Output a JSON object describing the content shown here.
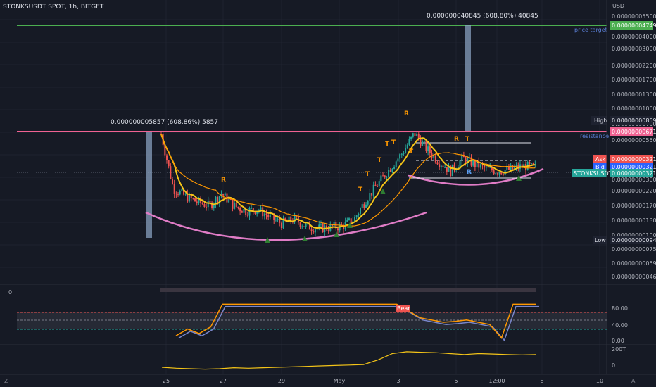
{
  "header": {
    "symbol_line": "STONKSUSDT SPOT, 1h, BITGET",
    "currency": "USDT"
  },
  "colors": {
    "background": "#161a25",
    "grid": "#1f2330",
    "up": "#26a69a",
    "down": "#ef5350",
    "green_line": "#4caf50",
    "pink_line": "#f06292",
    "bars_fill": "#8fa8c8",
    "orange": "#ff9800",
    "yellow": "#f5c518",
    "blue": "#5b7fd6"
  },
  "annotations": {
    "green_measure_label": "0.000000040845 (608.80%) 40845",
    "pink_measure_label": "0.000000005857 (608.86%) 5857",
    "price_target_label": "price target",
    "resistance_label": "resistance"
  },
  "markers": {
    "r_labels": [
      "R",
      "R",
      "R",
      "R"
    ],
    "t_labels": [
      "T",
      "T",
      "T",
      "T",
      "T",
      "T",
      "T"
    ],
    "bear_label": "Bear"
  },
  "price_scale": {
    "ticks": [
      "0.000000055000",
      "0.000000040000",
      "0.000000030000",
      "0.000000022000",
      "0.000000017000",
      "0.000000013000",
      "0.000000010000",
      "0.000000007500",
      "0.000000005500",
      "0.000000002200",
      "0.000000001700",
      "0.000000001300",
      "0.000000001000",
      "0.000000000750",
      "0.000000000590",
      "0.000000000460"
    ],
    "price_target_value": "0.000000047497",
    "high_label": "High",
    "high_value": "0.000000008599",
    "resistance_value": "0.000000006716",
    "ask_label": "Ask",
    "ask_value": "0.000000003214",
    "bid_label": "Bid",
    "bid_value": "0.000000003212",
    "last_label": "STONKSUSDT",
    "last_value": "0.000000003212",
    "low_label": "Low",
    "low_value": "0.000000000941",
    "partial_tick": "0.000000003000"
  },
  "osc_scale": [
    "80.00",
    "40.00",
    "0.00"
  ],
  "bottom_scale": [
    "200T",
    "0"
  ],
  "time_axis": [
    "25",
    "27",
    "29",
    "May",
    "3",
    "5",
    "12:00",
    "8",
    "10"
  ],
  "chart_data": {
    "type": "candlestick",
    "title": "STONKSUSDT SPOT, 1h, BITGET",
    "y_scale": "log",
    "x_labels": [
      "25",
      "27",
      "29",
      "May",
      "3",
      "5",
      "12:00",
      "8",
      "10"
    ],
    "x": [
      24.8,
      25.2,
      25.6,
      26.0,
      26.4,
      26.8,
      27.2,
      27.6,
      28.0,
      28.4,
      28.8,
      29.2,
      29.6,
      30.0,
      30.4,
      30.8,
      31.2,
      31.6,
      32.0,
      32.4,
      32.8,
      33.2,
      33.6,
      34.0,
      34.4,
      34.8,
      35.2,
      35.6,
      36.0,
      36.4,
      36.8,
      37.2
    ],
    "close": [
      5.9e-09,
      2.2e-09,
      1.9e-09,
      1.7e-09,
      1.6e-09,
      2e-09,
      1.6e-09,
      1.45e-09,
      1.5e-09,
      1.3e-09,
      1.15e-09,
      1.25e-09,
      1.1e-09,
      1.05e-09,
      1.08e-09,
      1.1e-09,
      1.25e-09,
      1.8e-09,
      2.4e-09,
      3.2e-09,
      4.2e-09,
      6e-09,
      4.5e-09,
      3.6e-09,
      3e-09,
      3.8e-09,
      3.4e-09,
      3.1e-09,
      3e-09,
      3.1e-09,
      3.3e-09,
      3.212e-09
    ],
    "high": 8.599e-09,
    "low": 9.41e-10,
    "price_target": 4.7497e-08,
    "resistance": 6.716e-09,
    "last": 3.212e-09,
    "oscillator": {
      "ylim": [
        0,
        100
      ],
      "levels": [
        80,
        40,
        0
      ],
      "values": [
        20,
        35,
        25,
        40,
        90,
        90,
        90,
        90,
        90,
        90,
        90,
        90,
        90,
        90,
        90,
        90,
        90,
        90,
        90,
        90,
        75,
        60,
        55,
        50,
        52,
        55,
        50,
        45,
        15,
        90,
        90,
        90
      ]
    },
    "bottom_indicator": {
      "ticks": [
        "200T",
        "0"
      ],
      "values": [
        0,
        -10,
        -15,
        -20,
        -15,
        -5,
        -10,
        -5,
        0,
        5,
        10,
        15,
        20,
        25,
        30,
        80,
        150,
        170,
        165,
        160,
        150,
        140,
        150,
        145,
        140,
        135,
        140
      ]
    }
  }
}
